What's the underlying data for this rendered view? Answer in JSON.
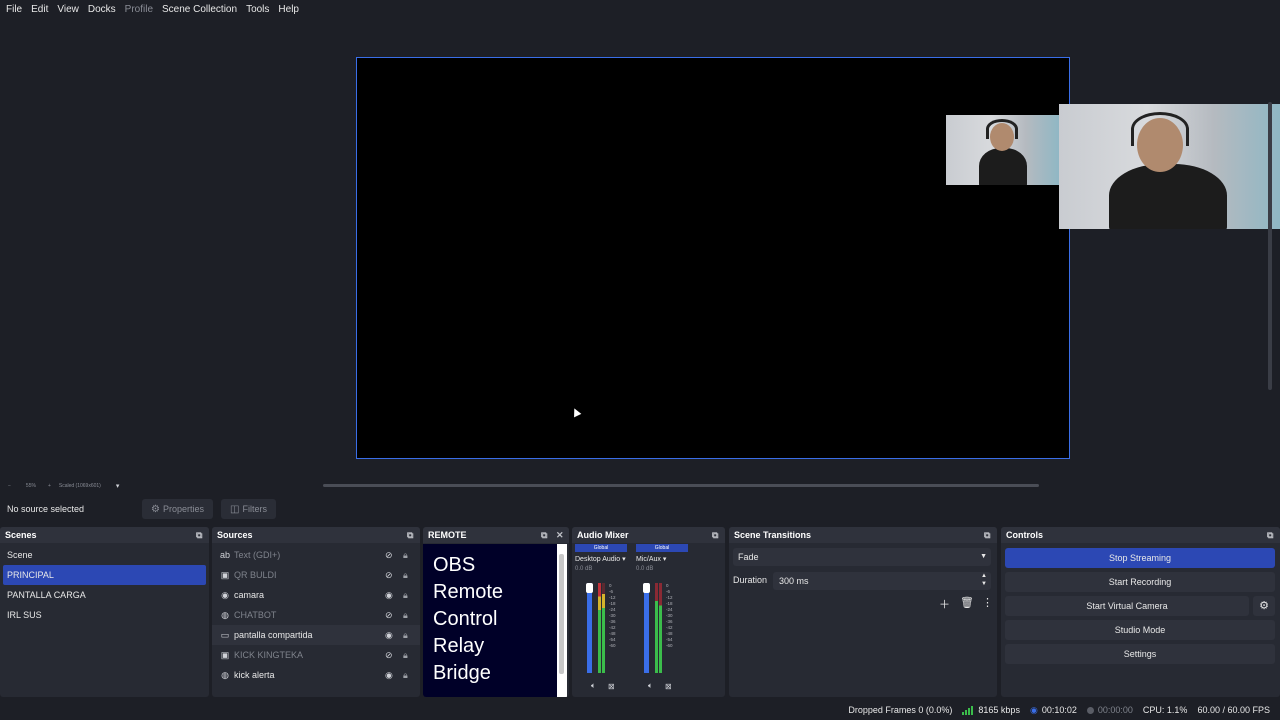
{
  "menu": {
    "items": [
      {
        "label": "File",
        "disabled": false
      },
      {
        "label": "Edit",
        "disabled": false
      },
      {
        "label": "View",
        "disabled": false
      },
      {
        "label": "Docks",
        "disabled": false
      },
      {
        "label": "Profile",
        "disabled": true
      },
      {
        "label": "Scene Collection",
        "disabled": false
      },
      {
        "label": "Tools",
        "disabled": false
      },
      {
        "label": "Help",
        "disabled": false
      }
    ]
  },
  "zoom": {
    "minus": "−",
    "value": "55%",
    "plus": "+",
    "mode": "Scaled (1069x601)"
  },
  "source_toolbar": {
    "no_source": "No source selected",
    "properties": "Properties",
    "filters": "Filters"
  },
  "scenes": {
    "title": "Scenes",
    "items": [
      "Scene",
      "PRINCIPAL",
      "PANTALLA CARGA",
      "IRL SUS"
    ],
    "selected": "PRINCIPAL"
  },
  "sources": {
    "title": "Sources",
    "items": [
      {
        "name": "Text (GDI+)",
        "icon": "text-icon",
        "visible": false
      },
      {
        "name": "QR BULDI",
        "icon": "image-icon",
        "visible": false
      },
      {
        "name": "camara",
        "icon": "camera-icon",
        "visible": true
      },
      {
        "name": "CHATBOT",
        "icon": "browser-icon",
        "visible": false
      },
      {
        "name": "pantalla compartida",
        "icon": "display-icon",
        "visible": true
      },
      {
        "name": "KICK KINGTEKA",
        "icon": "image-icon",
        "visible": false
      },
      {
        "name": "kick alerta",
        "icon": "browser-icon",
        "visible": true
      }
    ]
  },
  "remote": {
    "title": "REMOTE",
    "lines": [
      "OBS",
      "Remote",
      "Control",
      "Relay",
      "Bridge"
    ]
  },
  "mixer": {
    "title": "Audio Mixer",
    "channels": [
      {
        "global": "Global",
        "name": "Desktop Audio",
        "db": "0.0 dB"
      },
      {
        "global": "Global",
        "name": "Mic/Aux",
        "db": "0.0 dB"
      }
    ],
    "ticks": [
      "0",
      "-6",
      "-12",
      "-18",
      "-24",
      "-30",
      "-36",
      "-42",
      "-48",
      "-54",
      "-60"
    ]
  },
  "transitions": {
    "title": "Scene Transitions",
    "selected": "Fade",
    "duration_label": "Duration",
    "duration_value": "300 ms"
  },
  "controls": {
    "title": "Controls",
    "stop_streaming": "Stop Streaming",
    "start_recording": "Start Recording",
    "start_virtual_camera": "Start Virtual Camera",
    "studio_mode": "Studio Mode",
    "settings": "Settings"
  },
  "status": {
    "dropped_frames": "Dropped Frames 0 (0.0%)",
    "bitrate": "8165 kbps",
    "stream_time": "00:10:02",
    "record_time": "00:00:00",
    "cpu": "CPU: 1.1%",
    "fps": "60.00 / 60.00 FPS"
  },
  "colors": {
    "accent": "#2c48b4",
    "selection_border": "#3a6ee8",
    "panel_bg": "#272a33",
    "app_bg": "#1d1f26",
    "meter_green": "#3bbd4b",
    "meter_yellow": "#d4b42c",
    "meter_red": "#c0303a"
  }
}
